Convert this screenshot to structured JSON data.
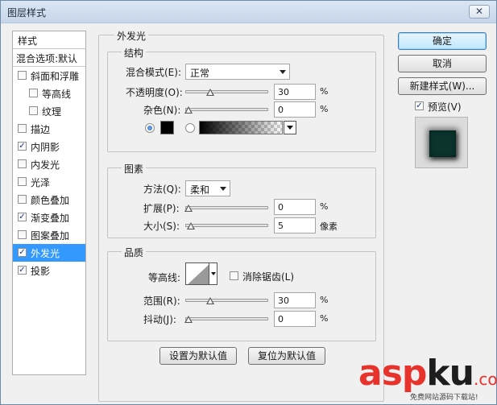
{
  "window": {
    "title": "图层样式",
    "close_glyph": "✕"
  },
  "styles_panel": {
    "header": "样式",
    "blend_options": "混合选项:默认",
    "items": [
      {
        "label": "斜面和浮雕",
        "checked": false
      },
      {
        "label": "等高线",
        "checked": false
      },
      {
        "label": "纹理",
        "checked": false
      },
      {
        "label": "描边",
        "checked": false
      },
      {
        "label": "内阴影",
        "checked": true
      },
      {
        "label": "内发光",
        "checked": false
      },
      {
        "label": "光泽",
        "checked": false
      },
      {
        "label": "颜色叠加",
        "checked": false
      },
      {
        "label": "渐变叠加",
        "checked": true
      },
      {
        "label": "图案叠加",
        "checked": false
      },
      {
        "label": "外发光",
        "checked": true
      },
      {
        "label": "投影",
        "checked": true
      }
    ]
  },
  "outer_glow": {
    "title": "外发光",
    "structure": {
      "title": "结构",
      "blend_mode_label": "混合模式(E):",
      "blend_mode_value": "正常",
      "opacity_label": "不透明度(O):",
      "opacity_value": "30",
      "opacity_unit": "%",
      "noise_label": "杂色(N):",
      "noise_value": "0",
      "noise_unit": "%",
      "color_swatch": "#000000"
    },
    "elements": {
      "title": "图素",
      "method_label": "方法(Q):",
      "method_value": "柔和",
      "spread_label": "扩展(P):",
      "spread_value": "0",
      "spread_unit": "%",
      "size_label": "大小(S):",
      "size_value": "5",
      "size_unit": "像素"
    },
    "quality": {
      "title": "品质",
      "contour_label": "等高线:",
      "antialias_label": "消除锯齿(L)",
      "range_label": "范围(R):",
      "range_value": "30",
      "range_unit": "%",
      "jitter_label": "抖动(J):",
      "jitter_value": "0",
      "jitter_unit": "%"
    },
    "make_default": "设置为默认值",
    "reset_default": "复位为默认值"
  },
  "right_panel": {
    "ok": "确定",
    "cancel": "取消",
    "new_style": "新建样式(W)...",
    "preview_label": "预览(V)",
    "preview_checked": true,
    "preview_color": "#0c332c"
  },
  "watermark": {
    "part1": "asp",
    "part2": "ku",
    "part3": ".com",
    "subtitle": "免费网站源码下载站!"
  }
}
